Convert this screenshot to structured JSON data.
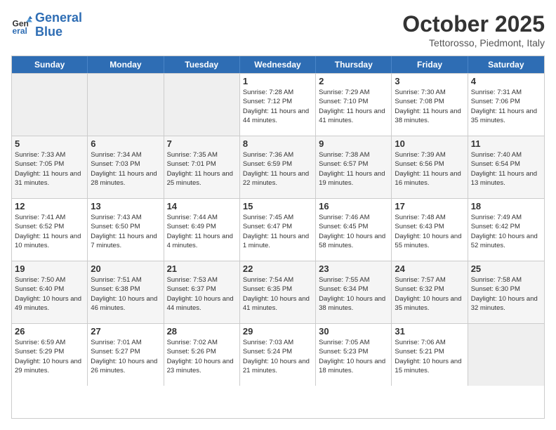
{
  "logo": {
    "line1": "General",
    "line2": "Blue"
  },
  "title": "October 2025",
  "location": "Tettorosso, Piedmont, Italy",
  "days_of_week": [
    "Sunday",
    "Monday",
    "Tuesday",
    "Wednesday",
    "Thursday",
    "Friday",
    "Saturday"
  ],
  "weeks": [
    [
      {
        "day": "",
        "info": ""
      },
      {
        "day": "",
        "info": ""
      },
      {
        "day": "",
        "info": ""
      },
      {
        "day": "1",
        "info": "Sunrise: 7:28 AM\nSunset: 7:12 PM\nDaylight: 11 hours and 44 minutes."
      },
      {
        "day": "2",
        "info": "Sunrise: 7:29 AM\nSunset: 7:10 PM\nDaylight: 11 hours and 41 minutes."
      },
      {
        "day": "3",
        "info": "Sunrise: 7:30 AM\nSunset: 7:08 PM\nDaylight: 11 hours and 38 minutes."
      },
      {
        "day": "4",
        "info": "Sunrise: 7:31 AM\nSunset: 7:06 PM\nDaylight: 11 hours and 35 minutes."
      }
    ],
    [
      {
        "day": "5",
        "info": "Sunrise: 7:33 AM\nSunset: 7:05 PM\nDaylight: 11 hours and 31 minutes."
      },
      {
        "day": "6",
        "info": "Sunrise: 7:34 AM\nSunset: 7:03 PM\nDaylight: 11 hours and 28 minutes."
      },
      {
        "day": "7",
        "info": "Sunrise: 7:35 AM\nSunset: 7:01 PM\nDaylight: 11 hours and 25 minutes."
      },
      {
        "day": "8",
        "info": "Sunrise: 7:36 AM\nSunset: 6:59 PM\nDaylight: 11 hours and 22 minutes."
      },
      {
        "day": "9",
        "info": "Sunrise: 7:38 AM\nSunset: 6:57 PM\nDaylight: 11 hours and 19 minutes."
      },
      {
        "day": "10",
        "info": "Sunrise: 7:39 AM\nSunset: 6:56 PM\nDaylight: 11 hours and 16 minutes."
      },
      {
        "day": "11",
        "info": "Sunrise: 7:40 AM\nSunset: 6:54 PM\nDaylight: 11 hours and 13 minutes."
      }
    ],
    [
      {
        "day": "12",
        "info": "Sunrise: 7:41 AM\nSunset: 6:52 PM\nDaylight: 11 hours and 10 minutes."
      },
      {
        "day": "13",
        "info": "Sunrise: 7:43 AM\nSunset: 6:50 PM\nDaylight: 11 hours and 7 minutes."
      },
      {
        "day": "14",
        "info": "Sunrise: 7:44 AM\nSunset: 6:49 PM\nDaylight: 11 hours and 4 minutes."
      },
      {
        "day": "15",
        "info": "Sunrise: 7:45 AM\nSunset: 6:47 PM\nDaylight: 11 hours and 1 minute."
      },
      {
        "day": "16",
        "info": "Sunrise: 7:46 AM\nSunset: 6:45 PM\nDaylight: 10 hours and 58 minutes."
      },
      {
        "day": "17",
        "info": "Sunrise: 7:48 AM\nSunset: 6:43 PM\nDaylight: 10 hours and 55 minutes."
      },
      {
        "day": "18",
        "info": "Sunrise: 7:49 AM\nSunset: 6:42 PM\nDaylight: 10 hours and 52 minutes."
      }
    ],
    [
      {
        "day": "19",
        "info": "Sunrise: 7:50 AM\nSunset: 6:40 PM\nDaylight: 10 hours and 49 minutes."
      },
      {
        "day": "20",
        "info": "Sunrise: 7:51 AM\nSunset: 6:38 PM\nDaylight: 10 hours and 46 minutes."
      },
      {
        "day": "21",
        "info": "Sunrise: 7:53 AM\nSunset: 6:37 PM\nDaylight: 10 hours and 44 minutes."
      },
      {
        "day": "22",
        "info": "Sunrise: 7:54 AM\nSunset: 6:35 PM\nDaylight: 10 hours and 41 minutes."
      },
      {
        "day": "23",
        "info": "Sunrise: 7:55 AM\nSunset: 6:34 PM\nDaylight: 10 hours and 38 minutes."
      },
      {
        "day": "24",
        "info": "Sunrise: 7:57 AM\nSunset: 6:32 PM\nDaylight: 10 hours and 35 minutes."
      },
      {
        "day": "25",
        "info": "Sunrise: 7:58 AM\nSunset: 6:30 PM\nDaylight: 10 hours and 32 minutes."
      }
    ],
    [
      {
        "day": "26",
        "info": "Sunrise: 6:59 AM\nSunset: 5:29 PM\nDaylight: 10 hours and 29 minutes."
      },
      {
        "day": "27",
        "info": "Sunrise: 7:01 AM\nSunset: 5:27 PM\nDaylight: 10 hours and 26 minutes."
      },
      {
        "day": "28",
        "info": "Sunrise: 7:02 AM\nSunset: 5:26 PM\nDaylight: 10 hours and 23 minutes."
      },
      {
        "day": "29",
        "info": "Sunrise: 7:03 AM\nSunset: 5:24 PM\nDaylight: 10 hours and 21 minutes."
      },
      {
        "day": "30",
        "info": "Sunrise: 7:05 AM\nSunset: 5:23 PM\nDaylight: 10 hours and 18 minutes."
      },
      {
        "day": "31",
        "info": "Sunrise: 7:06 AM\nSunset: 5:21 PM\nDaylight: 10 hours and 15 minutes."
      },
      {
        "day": "",
        "info": ""
      }
    ]
  ]
}
